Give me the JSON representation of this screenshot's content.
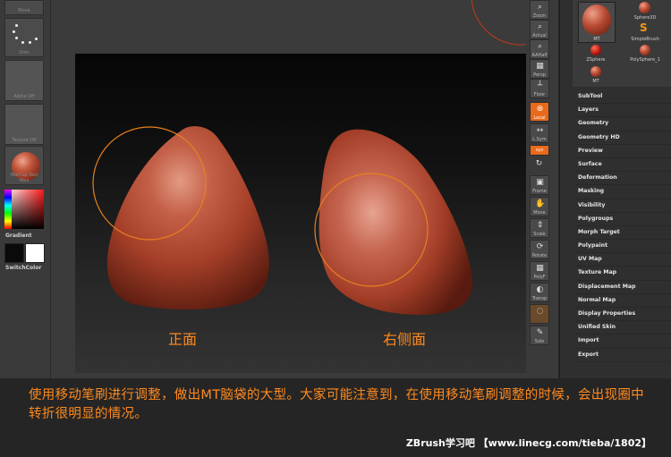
{
  "left_shelf": {
    "items": [
      {
        "name": "Move"
      },
      {
        "name": "Dots"
      },
      {
        "name": "Alpha Off"
      },
      {
        "name": "Texture Off"
      },
      {
        "name": "MatCap Red Wax"
      }
    ],
    "gradient_label": "Gradient",
    "switch_label": "SwitchColor",
    "primary_color": "#0a0a0a",
    "secondary_color": "#ffffff"
  },
  "right_toolbar": {
    "buttons": [
      "Zoom",
      "Actual",
      "AAHalf",
      "Persp",
      "Floor",
      "Local",
      "L.Sym",
      "xyz",
      "Frame",
      "Move",
      "Scale",
      "Rotate",
      "PolyF",
      "Transp",
      "Ghost",
      "Solo"
    ]
  },
  "tool_palette": {
    "current_tool_label": "MT",
    "items": [
      "Sphere3D",
      "SimpleBrush",
      "ZSphere",
      "PolySphere_1",
      "MT"
    ]
  },
  "tool_menu": [
    "SubTool",
    "Layers",
    "Geometry",
    "Geometry HD",
    "Preview",
    "Surface",
    "Deformation",
    "Masking",
    "Visibility",
    "Polygroups",
    "Morph Target",
    "Polypaint",
    "UV Map",
    "Texture Map",
    "Displacement Map",
    "Normal Map",
    "Display Properties",
    "Unified Skin",
    "Import",
    "Export"
  ],
  "viewport": {
    "front_label": "正面",
    "side_label": "右侧面",
    "model_color": "#b54a31",
    "brush_ring_color": "#e8801f"
  },
  "caption": {
    "text": "使用移动笔刷进行调整，做出MT脑袋的大型。大家可能注意到，在使用移动笔刷调整的时候，会出现圈中转折很明显的情况。",
    "credit": "ZBrush学习吧 【www.linecg.com/tieba/1802】"
  }
}
